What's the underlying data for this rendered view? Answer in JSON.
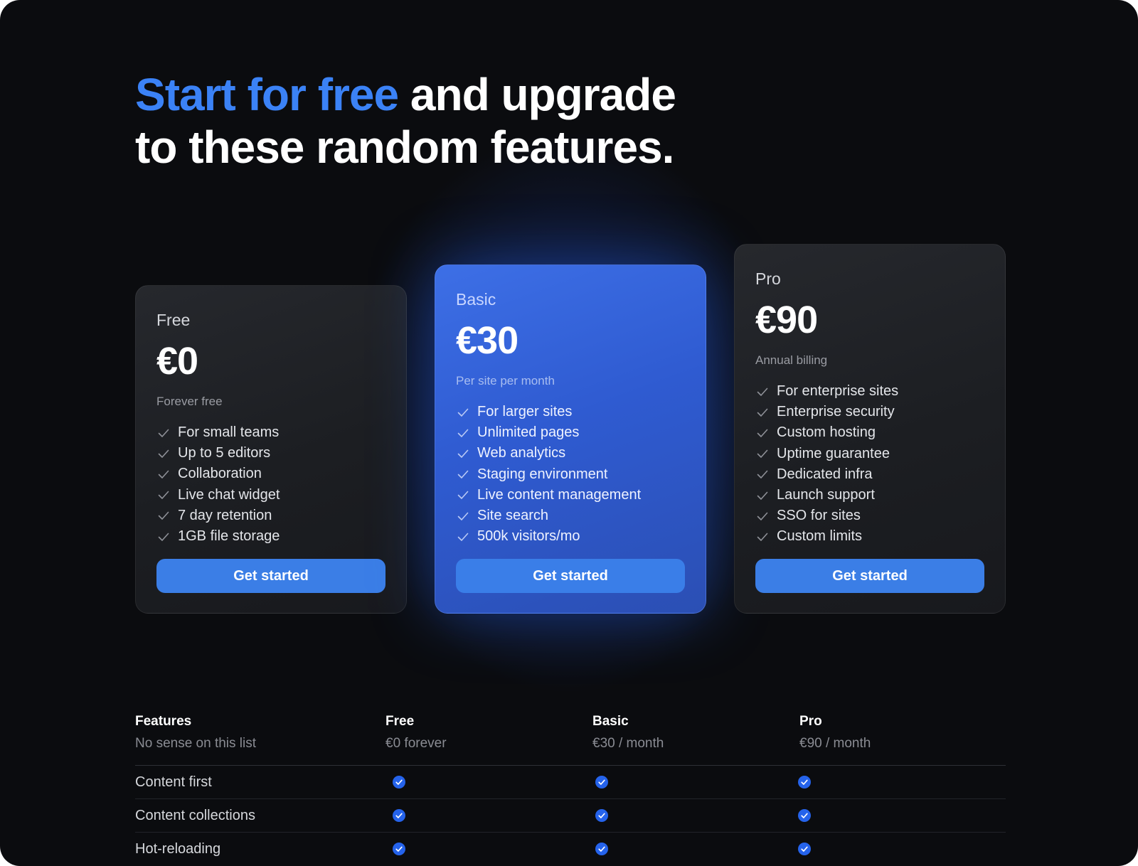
{
  "headline": {
    "accent": "Start for free",
    "rest1": " and upgrade",
    "line2": "to these random features."
  },
  "colors": {
    "accent": "#3b82f6",
    "background": "#0b0c0f",
    "button": "#3b7ee6",
    "highlight_card": "#2f5bd1",
    "check": "#2563eb"
  },
  "plans": [
    {
      "name": "Free",
      "price": "€0",
      "note": "Forever free",
      "features": [
        "For small teams",
        "Up to 5 editors",
        "Collaboration",
        "Live chat widget",
        "7 day retention",
        "1GB file storage"
      ],
      "cta": "Get started"
    },
    {
      "name": "Basic",
      "price": "€30",
      "note": "Per site per month",
      "features": [
        "For larger sites",
        "Unlimited pages",
        "Web analytics",
        "Staging environment",
        "Live content management",
        "Site search",
        "500k visitors/mo"
      ],
      "cta": "Get started"
    },
    {
      "name": "Pro",
      "price": "€90",
      "note": "Annual billing",
      "features": [
        "For enterprise sites",
        "Enterprise security",
        "Custom hosting",
        "Uptime guarantee",
        "Dedicated infra",
        "Launch support",
        "SSO for sites",
        "Custom limits"
      ],
      "cta": "Get started"
    }
  ],
  "comparison": {
    "columns": [
      {
        "title": "Features",
        "subtitle": "No sense on this list"
      },
      {
        "title": "Free",
        "subtitle": "€0 forever"
      },
      {
        "title": "Basic",
        "subtitle": "€30 / month"
      },
      {
        "title": "Pro",
        "subtitle": "€90 / month"
      }
    ],
    "rows": [
      {
        "label": "Content first",
        "values": [
          true,
          true,
          true
        ]
      },
      {
        "label": "Content collections",
        "values": [
          true,
          true,
          true
        ]
      },
      {
        "label": "Hot-reloading",
        "values": [
          true,
          true,
          true
        ]
      }
    ],
    "check_icon": "check-circle-icon"
  }
}
